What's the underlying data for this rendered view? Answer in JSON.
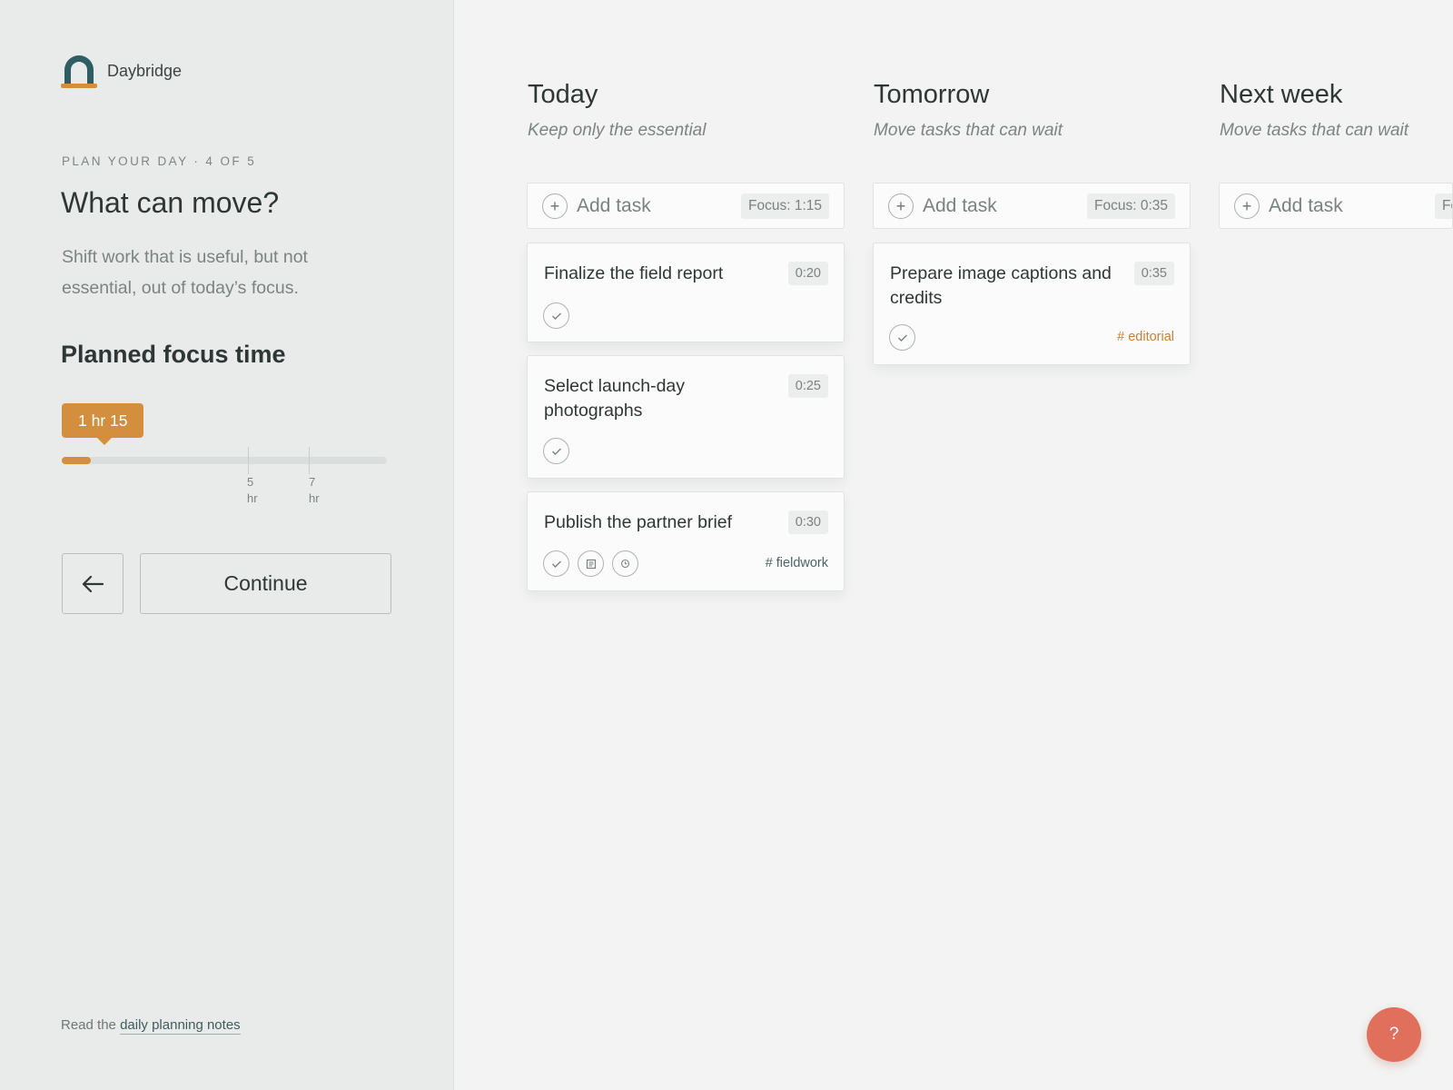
{
  "brand": {
    "name": "Daybridge",
    "logo_icon": "arch-logo-icon"
  },
  "step": {
    "eyebrow": "PLAN YOUR DAY · 4 OF 5",
    "title": "What can move?",
    "description": "Shift work that is useful, but not essential, out of today’s focus."
  },
  "focus": {
    "section_title": "Planned focus time",
    "value_label": "1 hr 15",
    "fill_fraction": 0.09,
    "ticks": [
      {
        "value": "5",
        "unit": "hr"
      },
      {
        "value": "7",
        "unit": "hr"
      }
    ]
  },
  "actions": {
    "back_icon": "arrow-left-icon",
    "continue_label": "Continue"
  },
  "footer": {
    "prefix": "Read the",
    "link_text": "daily planning notes"
  },
  "columns": [
    {
      "title": "Today",
      "subtitle": "Keep only the essential",
      "add_label": "Add task",
      "focus_label": "Focus: 1:15",
      "tasks": [
        {
          "title": "Finalize the field report",
          "time": "0:20"
        },
        {
          "title": "Select launch-day photographs",
          "time": "0:25"
        },
        {
          "title": "Publish the partner brief",
          "time": "0:30",
          "tag": "# fieldwork"
        }
      ]
    },
    {
      "title": "Tomorrow",
      "subtitle": "Move tasks that can wait",
      "add_label": "Add task",
      "focus_label": "Focus: 0:35",
      "tasks": [
        {
          "title": "Prepare image captions and credits",
          "time": "0:35",
          "tag": "# editorial"
        }
      ]
    },
    {
      "title": "Next week",
      "subtitle": "Move tasks that can wait",
      "add_label": "Add task",
      "focus_label": "Focus:",
      "tasks": []
    }
  ],
  "help": {
    "label": "?"
  },
  "colors": {
    "accent": "#d38f3d",
    "logo_teal": "#2f5d63",
    "help": "#e06f5b",
    "editorial_tag": "#c4823a",
    "fieldwork_tag": "#4d6464"
  }
}
